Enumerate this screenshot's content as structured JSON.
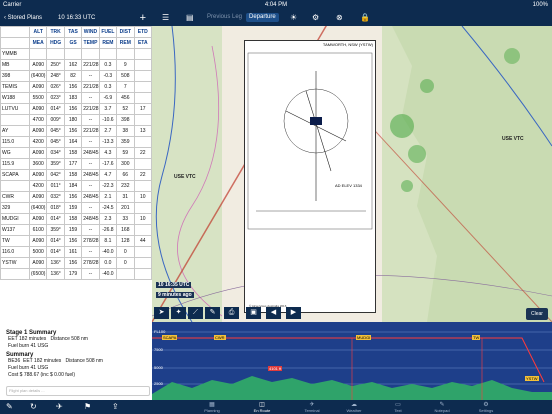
{
  "status_bar": {
    "carrier": "Carrier",
    "time": "4:04 PM",
    "battery": "100%"
  },
  "left_panel": {
    "back_label": "Stored Plans",
    "time_label": "10 16:33 UTC",
    "table_header": [
      "ALT",
      "TRK",
      "TAS",
      "WIND",
      "FUEL",
      "DIST",
      "ETD"
    ],
    "table_header2": [
      "MEA",
      "HDG",
      "GS",
      "TEMP",
      "REM",
      "REM",
      "ETA"
    ],
    "rows": [
      {
        "wp": "YMMB",
        "cells": [
          "",
          "",
          "",
          "",
          "",
          "",
          ""
        ]
      },
      {
        "wp": "MB",
        "cells": [
          "A090",
          "250°",
          "162",
          "221/28",
          "0.3",
          "9",
          ""
        ]
      },
      {
        "wp": "398",
        "cells": [
          "(6400)",
          "248°",
          "82",
          "--",
          "-0.3",
          "508",
          ""
        ]
      },
      {
        "wp": "TEMIS",
        "cells": [
          "A090",
          "026°",
          "156",
          "221/28",
          "0.3",
          "7",
          ""
        ]
      },
      {
        "wp": "W188",
        "cells": [
          "5500",
          "023°",
          "183",
          "--",
          "-6.9",
          "456",
          ""
        ]
      },
      {
        "wp": "LUTVU",
        "cells": [
          "A090",
          "014°",
          "156",
          "221/28",
          "3.7",
          "52",
          "17"
        ]
      },
      {
        "wp": "",
        "cells": [
          "4700",
          "009°",
          "180",
          "--",
          "-10.6",
          "398",
          ""
        ]
      },
      {
        "wp": "AY",
        "cells": [
          "A090",
          "045°",
          "156",
          "221/28",
          "2.7",
          "38",
          "13"
        ]
      },
      {
        "wp": "115.0",
        "cells": [
          "4200",
          "045°",
          "164",
          "--",
          "-13.3",
          "359",
          ""
        ]
      },
      {
        "wp": "WG",
        "cells": [
          "A090",
          "034°",
          "158",
          "248/45",
          "4.3",
          "59",
          "22"
        ]
      },
      {
        "wp": "115.9",
        "cells": [
          "3600",
          "359°",
          "177",
          "--",
          "-17.6",
          "300",
          ""
        ]
      },
      {
        "wp": "SCAPA",
        "cells": [
          "A090",
          "042°",
          "158",
          "248/45",
          "4.7",
          "66",
          "22"
        ]
      },
      {
        "wp": "",
        "cells": [
          "4200",
          "011°",
          "184",
          "--",
          "-22.3",
          "232",
          ""
        ]
      },
      {
        "wp": "CWR",
        "cells": [
          "A090",
          "032°",
          "156",
          "248/45",
          "2.1",
          "31",
          "10"
        ]
      },
      {
        "wp": "329",
        "cells": [
          "(6400)",
          "018°",
          "159",
          "--",
          "-24.5",
          "201",
          ""
        ]
      },
      {
        "wp": "MUDGI",
        "cells": [
          "A090",
          "014°",
          "158",
          "248/45",
          "2.3",
          "33",
          "10"
        ]
      },
      {
        "wp": "W137",
        "cells": [
          "6100",
          "359°",
          "159",
          "--",
          "-26.8",
          "168",
          ""
        ]
      },
      {
        "wp": "TW",
        "cells": [
          "A090",
          "014°",
          "156",
          "278/28",
          "8.1",
          "128",
          "44"
        ]
      },
      {
        "wp": "116.0",
        "cells": [
          "5000",
          "014°",
          "161",
          "--",
          "-40.0",
          "0",
          ""
        ]
      },
      {
        "wp": "YSTW",
        "cells": [
          "A090",
          "136°",
          "156",
          "278/28",
          "0.0",
          "0",
          ""
        ]
      },
      {
        "wp": "",
        "cells": [
          "(6500)",
          "136°",
          "179",
          "--",
          "-40.0",
          "",
          ""
        ]
      }
    ],
    "summary": {
      "stage_title": "Stage 1 Summary",
      "stage_eet": "EET 182 minutes",
      "stage_fuel": "Fuel burn 41 USG",
      "stage_dist": "Distance 508 nm",
      "summary_title": "Summary",
      "summary_be36": "BE36",
      "summary_eet": "EET 182 minutes",
      "summary_dist": "Distance 508 nm",
      "summary_fuel": "Fuel burn 41 USG",
      "summary_cost": "Cost $ 788.67 (inc $ 0.00 fuel)",
      "notes_placeholder": "Flight plan details ..."
    }
  },
  "top_bar": {
    "prev_leg": "Previous Leg",
    "departure": "Departure"
  },
  "map": {
    "plate_title": "TAMWORTH, NSW (YSTW)",
    "use_vtc_1": "USE VTC",
    "use_vtc_2": "USE VTC",
    "aircraft_time": "10 16:35 UTC",
    "aircraft_eta": "9 minutes ago",
    "ad_elev": "AD ELEV 1334",
    "copyright": "© Airservices Australia 2016",
    "clear_label": "Clear"
  },
  "profile": {
    "fl_labels": [
      "FL100",
      "7500",
      "5000",
      "2500"
    ],
    "waypoints": [
      "SCAPA",
      "CWR",
      "MUDGI",
      "TW"
    ],
    "alt_marker": "4101 ft",
    "dest": "YSTW"
  },
  "tabs": [
    "Planning",
    "En Route",
    "Terminal",
    "Weather",
    "Text",
    "Notepad",
    "Settings"
  ]
}
